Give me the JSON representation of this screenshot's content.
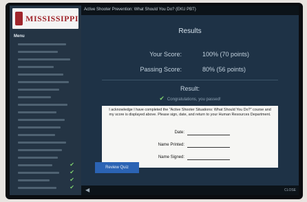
{
  "window": {
    "title": "Active Shooter Prevention: What Should You Do? (EKU PBT)"
  },
  "sidebar": {
    "logo_text": "MISSISSIPPI",
    "menu_label": "Menu",
    "items": [
      {
        "completed": false
      },
      {
        "completed": false
      },
      {
        "completed": false
      },
      {
        "completed": false
      },
      {
        "completed": false
      },
      {
        "completed": false
      },
      {
        "completed": false
      },
      {
        "completed": false
      },
      {
        "completed": false
      },
      {
        "completed": false
      },
      {
        "completed": false
      },
      {
        "completed": false
      },
      {
        "completed": false
      },
      {
        "completed": false
      },
      {
        "completed": false
      },
      {
        "completed": false
      },
      {
        "completed": true
      },
      {
        "completed": true
      },
      {
        "completed": true
      },
      {
        "completed": true
      }
    ]
  },
  "results": {
    "title": "Results",
    "score_label": "Your Score:",
    "score_value": "100% (70 points)",
    "passing_label": "Passing Score:",
    "passing_value": "80% (56 points)",
    "result_title": "Result:",
    "result_text": "Congratulations, you passed!"
  },
  "form": {
    "ack_text": "I acknowledge I have completed the \"Active Shooter Situations: What Should You Do?\" course and my score is displayed above. Please sign, date, and return to your Human Resources Department.",
    "date_label": "Date:",
    "name_printed_label": "Name Printed:",
    "name_signed_label": "Name Signed:"
  },
  "actions": {
    "review_label": "Review Quiz"
  },
  "footer": {
    "right_text": "CLOSE"
  },
  "colors": {
    "accent": "#2b63b4",
    "brand": "#a0262c",
    "check": "#7fd06e"
  }
}
